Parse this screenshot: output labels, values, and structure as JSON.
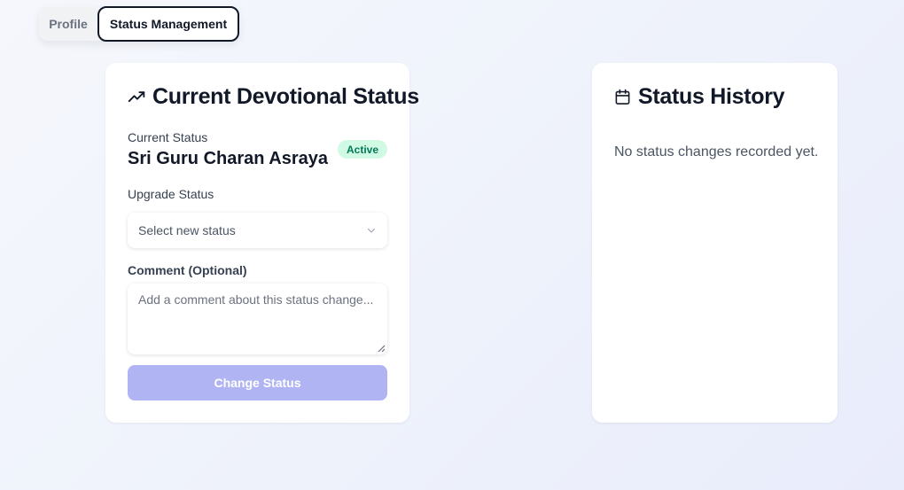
{
  "tabs": [
    {
      "label": "Profile",
      "active": false
    },
    {
      "label": "Status Management",
      "active": true
    }
  ],
  "status_card": {
    "title": "Current Devotional Status",
    "title_icon": "trending-up-icon",
    "current_status_label": "Current Status",
    "current_status_value": "Sri Guru Charan Asraya",
    "badge": "Active",
    "upgrade_label": "Upgrade Status",
    "select_placeholder": "Select new status",
    "comment_label": "Comment (Optional)",
    "comment_placeholder": "Add a comment about this status change...",
    "submit_label": "Change Status"
  },
  "history_card": {
    "title": "Status History",
    "title_icon": "calendar-icon",
    "empty_text": "No status changes recorded yet."
  },
  "colors": {
    "badge_bg": "#d1fae5",
    "badge_text": "#047857",
    "button_disabled": "#b1b4f3"
  }
}
